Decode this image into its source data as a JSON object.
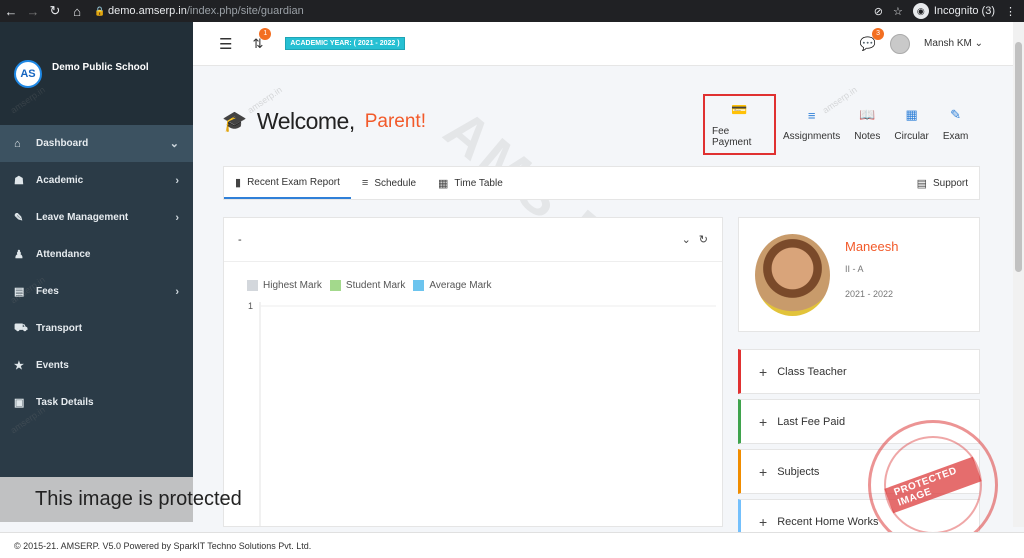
{
  "browser": {
    "back_icon": "←",
    "forward_icon": "→",
    "reload_icon": "↻",
    "home_icon": "⌂",
    "lock_icon": "🔒",
    "url_host": "demo.amserp.in",
    "url_path": "/index.php/site/guardian",
    "eye_off_icon": "⊘",
    "star_icon": "☆",
    "incognito_label": "Incognito (3)",
    "menu_icon": "⋮"
  },
  "sidebar": {
    "logo_text": "AS",
    "school_name": "Demo Public School",
    "items": [
      {
        "icon": "⌂",
        "label": "Dashboard",
        "arrow": "⌄"
      },
      {
        "icon": "☗",
        "label": "Academic",
        "arrow": "›"
      },
      {
        "icon": "✎",
        "label": "Leave Management",
        "arrow": "›"
      },
      {
        "icon": "♟",
        "label": "Attendance",
        "arrow": ""
      },
      {
        "icon": "▤",
        "label": "Fees",
        "arrow": "›"
      },
      {
        "icon": "⛟",
        "label": "Transport",
        "arrow": ""
      },
      {
        "icon": "★",
        "label": "Events",
        "arrow": ""
      },
      {
        "icon": "▣",
        "label": "Task Details",
        "arrow": ""
      }
    ]
  },
  "topbar": {
    "hamburger_icon": "☰",
    "swap_icon": "⇅",
    "swap_badge": "1",
    "academic_year": "ACADEMIC YEAR: ( 2021 - 2022 )",
    "chat_icon": "💬",
    "chat_badge": "3",
    "user_name": "Mansh KM ⌄"
  },
  "welcome": {
    "cap_icon": "🎓",
    "greeting": "Welcome,",
    "role": "Parent!"
  },
  "quick_links": [
    {
      "icon": "💳",
      "label": "Fee Payment"
    },
    {
      "icon": "≡",
      "label": "Assignments"
    },
    {
      "icon": "📖",
      "label": "Notes"
    },
    {
      "icon": "▦",
      "label": "Circular"
    },
    {
      "icon": "✎",
      "label": "Exam"
    }
  ],
  "tabs": [
    {
      "icon": "▮",
      "label": "Recent Exam Report"
    },
    {
      "icon": "≡",
      "label": "Schedule"
    },
    {
      "icon": "▦",
      "label": "Time Table"
    }
  ],
  "support": {
    "icon": "▤",
    "label": "Support"
  },
  "exam_card": {
    "title": "-",
    "collapse_icon": "⌄",
    "refresh_icon": "↻"
  },
  "chart_data": {
    "type": "bar",
    "categories": [],
    "series": [
      {
        "name": "Highest Mark",
        "color": "#d3d7dc",
        "values": []
      },
      {
        "name": "Student Mark",
        "color": "#a3d98c",
        "values": []
      },
      {
        "name": "Average Mark",
        "color": "#6cc4ee",
        "values": []
      }
    ],
    "yticks": [
      "1"
    ]
  },
  "student": {
    "name": "Maneesh",
    "class": "II - A",
    "year": "2021 - 2022"
  },
  "accordion": [
    {
      "label": "Class Teacher",
      "color": "#e03131"
    },
    {
      "label": "Last Fee Paid",
      "color": "#3fa34d"
    },
    {
      "label": "Subjects",
      "color": "#f08c00"
    },
    {
      "label": "Recent Home Works",
      "color": "#74c0fc"
    }
  ],
  "overlay": {
    "protected_text": "This image is protected",
    "stamp_text": "PROTECTED IMAGE"
  },
  "footer": {
    "text": "© 2015-21. AMSERP. V5.0 Powered by SparkIT Techno Solutions Pvt. Ltd."
  },
  "watermark": {
    "big": "AMS ERP",
    "small": "amserp.in"
  }
}
